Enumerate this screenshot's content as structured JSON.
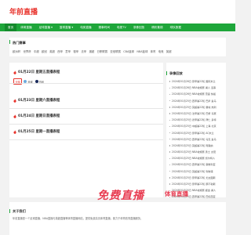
{
  "header": {
    "logo": "年前直播"
  },
  "nav": {
    "items": [
      {
        "label": "首页",
        "active": true
      },
      {
        "label": "体育直播"
      },
      {
        "label": "足球直播 ▾"
      },
      {
        "label": "篮球直播 ▾"
      },
      {
        "label": "电竞直播"
      },
      {
        "label": "赛事时间"
      },
      {
        "label": "电视TV"
      },
      {
        "label": "录像回放"
      },
      {
        "label": "精彩集锦"
      },
      {
        "label": "球队数据"
      }
    ]
  },
  "hot": {
    "title": "热门赛事",
    "tags": [
      "欧洲杯",
      "世界杯",
      "中超",
      "欧冠",
      "英超",
      "西甲",
      "意甲",
      "德甲",
      "法甲",
      "澳超",
      "日职联赛",
      "亚冠联赛",
      "CBA篮球",
      "NBA篮球",
      "体育",
      "电竞",
      "英超"
    ]
  },
  "days": [
    {
      "title": "01月22日 星期五直播表程",
      "matches": [
        {
          "badge": "全部",
          "home": "曼城",
          "away": "热刺"
        }
      ]
    },
    {
      "title": "01月23日 星期六直播表程"
    },
    {
      "title": "01月24日 星期日直播表程"
    },
    {
      "title": "01月25日 星期一直播表程"
    }
  ],
  "recordings": {
    "title": "录像回放",
    "items": [
      "2024年01月26日 意甲第22轮 国际米兰",
      "2024年01月26日 NBA常规赛 湖人 活塞",
      "2024年01月26日 NBA常规赛 雷霆 快船",
      "2024年01月25日 西甲第22轮 巴萨 皇马",
      "2024年01月25日 英超第22轮 曼城 热刺",
      "2024年01月25日 法甲第22轮 巴黎 马赛",
      "2024年01月25日 德甲第22轮 拜仁 多特",
      "2024年01月25日 中超第22轮 上海 北京",
      "2024年01月25日 意甲第22轮 AC米兰",
      "2024年01月25日 西甲第22轮 马竞 皇马",
      "2024年01月25日 英超第22轮 阿森纳",
      "2024年01月25日 NBA常规赛 勇士 太阳",
      "2024年01月25日 NBA常规赛 凯尔特人",
      "2024年01月25日 西甲第22轮 塞维利亚",
      "2024年01月25日 英超第22轮 利物浦",
      "2024年01月25日 意甲第22轮 尤文图斯",
      "2024年01月25日 意甲第22轮 那不勒斯",
      "2024年01月25日 NBA常规赛 掘金 湖人",
      "2024年01月25日 西甲第22轮 巴伦西亚"
    ]
  },
  "banner": {
    "text": "免费直播",
    "sub": "体育直播"
  },
  "footer": {
    "title": "关于我们",
    "text": "年前直播是一个足球直播、NBA直播与英超直播等体育直播网站，提供免费高清体育直播，致力于体育赛事直播服务。"
  },
  "colors": {
    "brand_green": "#1ea63a",
    "logo_red": "#e8322b",
    "banner_red": "#e83d52"
  }
}
